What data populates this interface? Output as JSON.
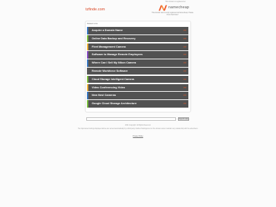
{
  "site": {
    "domain": "tzfinde.com"
  },
  "namecheap": {
    "tagline": "This domain is registered at",
    "brand": "namecheap",
    "description": "This domain was recently registered at Namecheap. Please check back later!",
    "brand_color": "#f05a2b"
  },
  "related": {
    "label": "Related Links",
    "items": [
      {
        "label": "Acquire a Domain Name",
        "accent": "#3a78c2"
      },
      {
        "label": "Online Data Backup and Recovery",
        "accent": "#7bbf3f"
      },
      {
        "label": "Fleet Management Camera",
        "accent": "#f0b33a"
      },
      {
        "label": "Software to Manage Remote Employees",
        "accent": "#8a4ec4"
      },
      {
        "label": "Where Can I Sell My Nikon Camera",
        "accent": "#3a78c2"
      },
      {
        "label": "Remote Workforce Software",
        "accent": "#5a5a5a"
      },
      {
        "label": "Cloud Storage Intelligent Camera",
        "accent": "#7bbf3f"
      },
      {
        "label": "Video Conferencing Video",
        "accent": "#f0b33a"
      },
      {
        "label": "New Nest Cameras",
        "accent": "#3a78c2"
      },
      {
        "label": "Google Cloud Storage Architecture",
        "accent": "#7bbf3f"
      }
    ],
    "arrow_glyph": ">>"
  },
  "search": {
    "button_label": "Search Ads"
  },
  "footer": {
    "copyright": "2024 Copyright. All Rights Reserved.",
    "disclaimer": "The Sponsored Listings displayed above are served automatically by a third party. Neither Parkingcrew nor the domain owner maintain any relationship with the advertisers.",
    "privacy": "Privacy Policy"
  }
}
